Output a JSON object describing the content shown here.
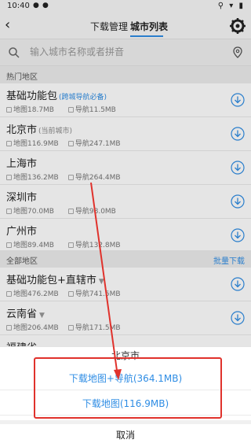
{
  "status": {
    "time": "10:40"
  },
  "header": {
    "tabs": [
      {
        "label": "下载管理"
      },
      {
        "label": "城市列表"
      }
    ]
  },
  "search": {
    "placeholder": "输入城市名称或者拼音"
  },
  "hot_section": {
    "label": "热门地区"
  },
  "hot_cities": [
    {
      "name": "基础功能包",
      "tag": "跨城导航必备",
      "map": "地图18.7MB",
      "nav": "导航11.5MB"
    },
    {
      "name": "北京市",
      "tag": "当前城市",
      "map": "地图116.9MB",
      "nav": "导航247.1MB"
    },
    {
      "name": "上海市",
      "tag": "",
      "map": "地图136.2MB",
      "nav": "导航264.4MB"
    },
    {
      "name": "深圳市",
      "tag": "",
      "map": "地图70.0MB",
      "nav": "导航98.0MB"
    },
    {
      "name": "广州市",
      "tag": "",
      "map": "地图89.4MB",
      "nav": "导航132.8MB"
    }
  ],
  "all_section": {
    "label": "全部地区",
    "batch": "批量下载"
  },
  "all_regions": [
    {
      "name": "基础功能包+直辖市",
      "map": "地图476.2MB",
      "nav": "导航741.5MB"
    },
    {
      "name": "云南省",
      "map": "地图206.4MB",
      "nav": "导航171.5MB"
    },
    {
      "name": "福建省"
    }
  ],
  "sheet": {
    "title": "北京市",
    "option1": "下载地图+导航(364.1MB)",
    "option2": "下载地图(116.9MB)",
    "cancel": "取消"
  },
  "colors": {
    "accent": "#2f8de4",
    "highlight": "#e0322c"
  }
}
